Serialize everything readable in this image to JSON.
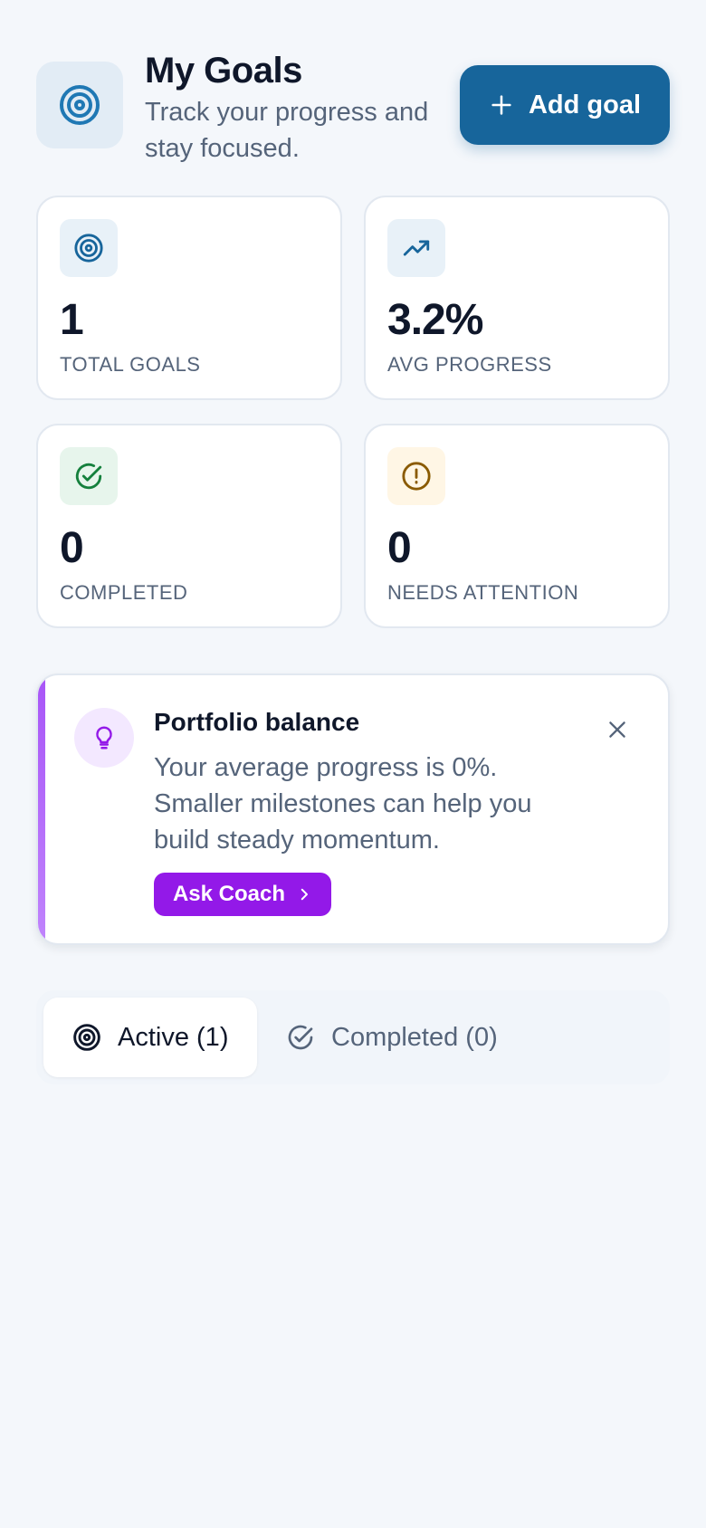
{
  "header": {
    "title": "My Goals",
    "subtitle": "Track your progress and stay focused.",
    "add_button_label": "Add goal",
    "icon": "target-icon"
  },
  "stats": [
    {
      "icon": "target-icon",
      "value": "1",
      "label": "TOTAL GOALS",
      "icon_color": "#17659b",
      "icon_bg": "#e8f1f8"
    },
    {
      "icon": "trending-up-icon",
      "value": "3.2%",
      "label": "AVG PROGRESS",
      "icon_color": "#17659b",
      "icon_bg": "#e8f1f8"
    },
    {
      "icon": "check-circle-icon",
      "value": "0",
      "label": "COMPLETED",
      "icon_color": "#15803d",
      "icon_bg": "#e7f5ec"
    },
    {
      "icon": "alert-circle-icon",
      "value": "0",
      "label": "NEEDS ATTENTION",
      "icon_color": "#8a5a00",
      "icon_bg": "#fff6e5"
    }
  ],
  "tip": {
    "title": "Portfolio balance",
    "text": "Your average progress is 0%. Smaller milestones can help you build steady momentum.",
    "button_label": "Ask Coach",
    "accent": "#9319e8",
    "icon": "lightbulb-icon"
  },
  "tabs": [
    {
      "label": "Active (1)",
      "icon": "target-icon",
      "active": true
    },
    {
      "label": "Completed (0)",
      "icon": "check-circle-icon",
      "active": false
    }
  ],
  "colors": {
    "primary": "#17659b",
    "background": "#f4f7fb",
    "coach": "#9319e8"
  }
}
